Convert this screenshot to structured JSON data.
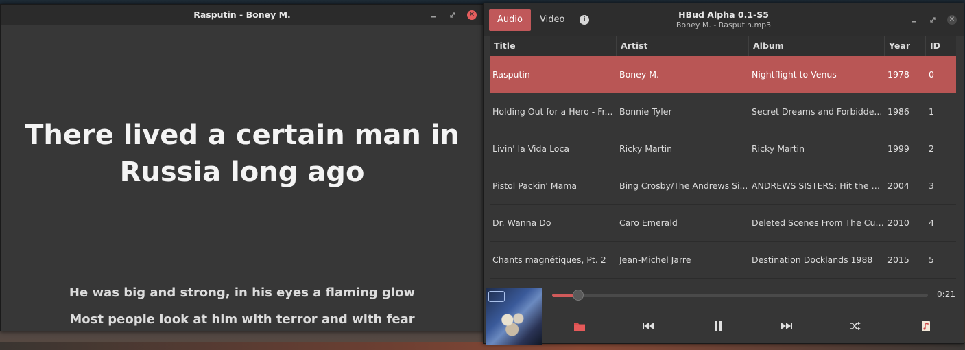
{
  "lyrics_window": {
    "title": "Rasputin - Boney M.",
    "current_line": "There lived a certain man in Russia long ago",
    "next_lines": [
      "He was big and strong, in his eyes a flaming glow",
      "Most people look at him with terror and with fear"
    ]
  },
  "player_window": {
    "tabs": [
      "Audio",
      "Video"
    ],
    "active_tab": "Audio",
    "app_title": "HBud Alpha 0.1-S5",
    "now_playing_file": "Boney M. - Rasputin.mp3",
    "columns": [
      "Title",
      "Artist",
      "Album",
      "Year",
      "ID"
    ],
    "rows": [
      {
        "title": "Rasputin",
        "artist": "Boney M.",
        "album": "Nightflight to Venus",
        "year": "1978",
        "id": "0",
        "selected": true
      },
      {
        "title": "Holding Out for a Hero - Fr...",
        "artist": "Bonnie Tyler",
        "album": "Secret Dreams and Forbidde...",
        "year": "1986",
        "id": "1"
      },
      {
        "title": "Livin' la Vida Loca",
        "artist": "Ricky Martin",
        "album": "Ricky Martin",
        "year": "1999",
        "id": "2"
      },
      {
        "title": "Pistol Packin' Mama",
        "artist": "Bing Crosby/The Andrews Si...",
        "album": "ANDREWS SISTERS: Hit the R...",
        "year": "2004",
        "id": "3"
      },
      {
        "title": "Dr. Wanna Do",
        "artist": "Caro Emerald",
        "album": "Deleted Scenes From The Cut...",
        "year": "2010",
        "id": "4"
      },
      {
        "title": "Chants magnétiques, Pt. 2",
        "artist": "Jean-Michel Jarre",
        "album": "Destination Docklands 1988",
        "year": "2015",
        "id": "5"
      }
    ],
    "elapsed_time": "0:21",
    "progress_fraction": 0.07,
    "controls": [
      "folder-icon",
      "previous-icon",
      "pause-icon",
      "next-icon",
      "shuffle-icon",
      "playlist-icon"
    ],
    "accent_color": "#c0585a"
  }
}
